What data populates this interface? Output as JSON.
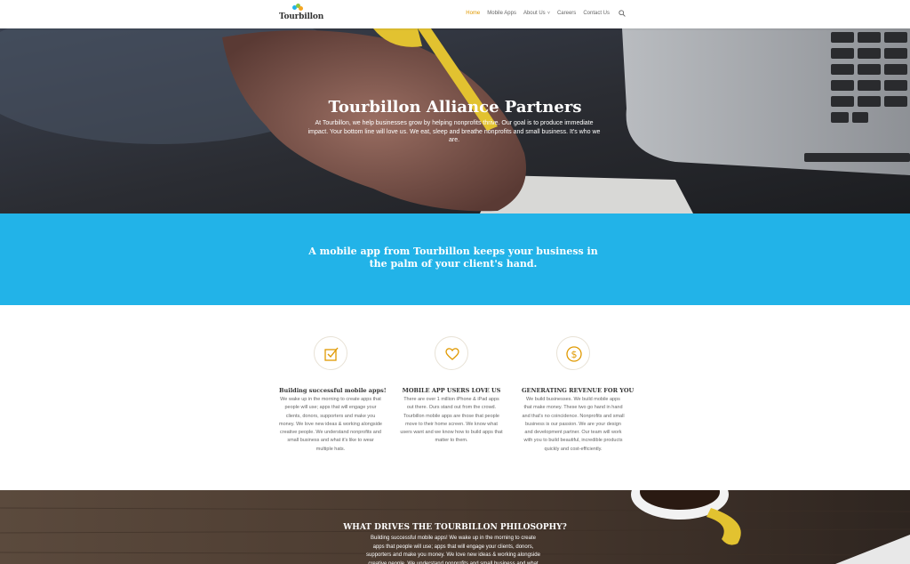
{
  "header": {
    "logo_text": "Tourbillon",
    "nav": [
      {
        "label": "Home",
        "active": true
      },
      {
        "label": "Mobile Apps"
      },
      {
        "label": "About Us",
        "dropdown": true
      },
      {
        "label": "Careers"
      },
      {
        "label": "Contact Us"
      }
    ],
    "accent_color": "#e09900"
  },
  "hero": {
    "title": "Tourbillon Alliance Partners",
    "text": "At Tourbillon, we help businesses grow by helping nonprofits thrive. Our goal is to produce immediate impact. Your bottom line will love us. We eat, sleep and breathe nonprofits and small business. It's who we are."
  },
  "band": {
    "text": "A mobile app from Tourbillon keeps your business in the palm of your client's hand.",
    "color": "#22b3e8"
  },
  "features": [
    {
      "icon": "checkbox-icon",
      "title": "Building successful mobile apps!",
      "text": "We wake up in the morning to create apps that people will use; apps that will engage your clients, donors, supporters and make you money. We love new ideas & working alongside creative people. We understand nonprofits and small business and what it's like to wear multiple hats."
    },
    {
      "icon": "heart-icon",
      "title": "MOBILE APP USERS LOVE US",
      "text": "There are over 1 million iPhone & iPad apps out there. Ours stand out from the crowd. Tourbillon mobile apps are those that people move to their home screen. We know what users want and we know how to build apps that matter to them."
    },
    {
      "icon": "dollar-icon",
      "title": "GENERATING REVENUE FOR YOU",
      "text": "We build businesses. We build mobile apps that make money. These two go hand in hand and that's no coincidence. Nonprofits and small business is our passion. We are your design and development partner. Our team will work with you to build beautiful, incredible products quickly and cost-efficiently."
    }
  ],
  "bottom": {
    "title": "WHAT DRIVES THE TOURBILLON PHILOSOPHY?",
    "text": "Building successful mobile apps! We wake up in the morning to create apps that people will use; apps that will engage your clients, donors, supporters and make you money. We love new ideas & working alongside creative people. We understand nonprofits and small business and what"
  }
}
